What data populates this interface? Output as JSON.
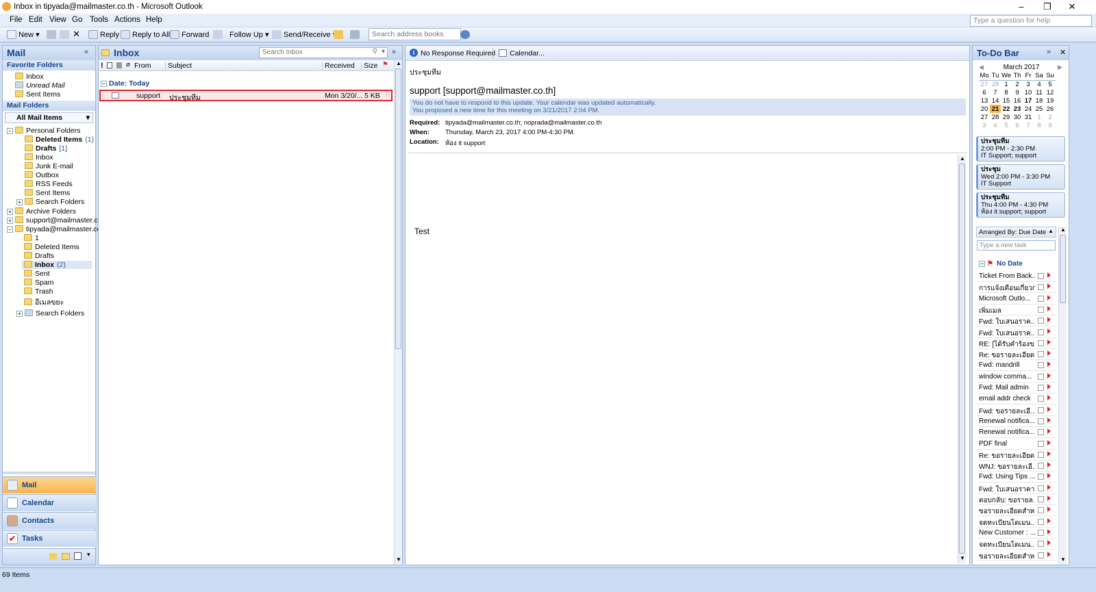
{
  "window": {
    "title": "Inbox in tipyada@mailmaster.co.th - Microsoft Outlook",
    "minimize": "–",
    "restore": "❐",
    "close": "✕"
  },
  "menu": {
    "file": "File",
    "edit": "Edit",
    "view": "View",
    "go": "Go",
    "tools": "Tools",
    "actions": "Actions",
    "help": "Help",
    "help_placeholder": "Type a question for help"
  },
  "toolbar": {
    "new": "New",
    "reply": "Reply",
    "reply_all": "Reply to All",
    "forward": "Forward",
    "follow_up": "Follow Up",
    "send_receive": "Send/Receive",
    "address_search_placeholder": "Search address books"
  },
  "nav": {
    "title": "Mail",
    "favorite_folders_label": "Favorite Folders",
    "favorites": [
      "Inbox",
      "Unread Mail",
      "Sent Items"
    ],
    "mail_folders_label": "Mail Folders",
    "all_mail_items": "All Mail Items",
    "personal_folders": "Personal Folders",
    "personal_children": [
      {
        "name": "Deleted Items",
        "count": "(1)"
      },
      {
        "name": "Drafts",
        "count": "[1]"
      },
      {
        "name": "Inbox",
        "count": ""
      },
      {
        "name": "Junk E-mail",
        "count": ""
      },
      {
        "name": "Outbox",
        "count": ""
      },
      {
        "name": "RSS Feeds",
        "count": ""
      },
      {
        "name": "Sent Items",
        "count": ""
      },
      {
        "name": "Search Folders",
        "count": ""
      }
    ],
    "archive_folders": "Archive Folders",
    "support_account": "support@mailmaster.co",
    "tipyada_account": "tipyada@mailmaster.co.",
    "tipyada_children": [
      {
        "name": "1",
        "count": ""
      },
      {
        "name": "Deleted Items",
        "count": ""
      },
      {
        "name": "Drafts",
        "count": ""
      },
      {
        "name": "Inbox",
        "count": "(2)"
      },
      {
        "name": "Sent",
        "count": ""
      },
      {
        "name": "Spam",
        "count": ""
      },
      {
        "name": "Trash",
        "count": ""
      },
      {
        "name": "อีเมลขยะ",
        "count": ""
      }
    ],
    "search_folders": "Search Folders",
    "buttons": [
      "Mail",
      "Calendar",
      "Contacts",
      "Tasks"
    ]
  },
  "inbox": {
    "title": "Inbox",
    "search_placeholder": "Search Inbox",
    "columns": {
      "from": "From",
      "subject": "Subject",
      "received": "Received",
      "size": "Size"
    },
    "group_label": "Date: Today",
    "messages": [
      {
        "from": "support",
        "subject": "ประชุมทีม",
        "received": "Mon 3/20/...",
        "size": "5 KB"
      }
    ]
  },
  "reading": {
    "no_response": "No Response Required",
    "calendar": "Calendar...",
    "subject": "ประชุมทีม",
    "sender": "support [support@mailmaster.co.th]",
    "info_line1": "You do not have to respond to this update. Your calendar was updated automatically.",
    "info_line2": "You proposed a new time for this meeting on 3/21/2017 2:04 PM.",
    "required_label": "Required:",
    "required_value": "tipyada@mailmaster.co.th; noprada@mailmaster.co.th",
    "when_label": "When:",
    "when_value": "Thursday, March 23, 2017 4:00 PM-4:30 PM.",
    "location_label": "Location:",
    "location_value": "ห้อง it support",
    "body": "Test"
  },
  "todo": {
    "title": "To-Do Bar",
    "month": "March 2017",
    "weekdays": [
      "Mo",
      "Tu",
      "We",
      "Th",
      "Fr",
      "Sa",
      "Su"
    ],
    "weeks": [
      [
        "27",
        "28",
        "1",
        "2",
        "3",
        "4",
        "5"
      ],
      [
        "6",
        "7",
        "8",
        "9",
        "10",
        "11",
        "12"
      ],
      [
        "13",
        "14",
        "15",
        "16",
        "17",
        "18",
        "19"
      ],
      [
        "20",
        "21",
        "22",
        "23",
        "24",
        "25",
        "26"
      ],
      [
        "27",
        "28",
        "29",
        "30",
        "31",
        "1",
        "2"
      ],
      [
        "3",
        "4",
        "5",
        "6",
        "7",
        "8",
        "9"
      ]
    ],
    "appointments": [
      {
        "title": "ประชุมทีม",
        "time": "2:00 PM - 2:30 PM",
        "where": "IT Support; support"
      },
      {
        "title": "ประชุม",
        "time": "Wed 2:00 PM - 3:30 PM",
        "where": "IT Support"
      },
      {
        "title": "ประชุมทีม",
        "time": "Thu 4:00 PM - 4:30 PM",
        "where": "ห้อง it support; support"
      }
    ],
    "arranged_by": "Arranged By: Due Date",
    "new_task_placeholder": "Type a new task",
    "no_date": "No Date",
    "tasks": [
      "Ticket From Back...",
      "การแจ้งเตือนเกี่ยวก...",
      "Microsoft Outlo...",
      "เพิ่มเมล",
      "Fwd: ใบเสนอราค...",
      "Fwd: ใบเสนอราค...",
      "RE: [ได้รับคำร้องข...",
      "Re: ขอรายละเอียด...",
      "Fwd: mandrill",
      "window comma...",
      "Fwd: Mail admin",
      "email addr check",
      "Fwd: ขอรายละเอี...",
      "Renewal notifica...",
      "Renewal notifica...",
      "PDF final",
      "Re: ขอรายละเอียด...",
      "WNJ: ขอรายละเอี...",
      "Fwd: Using Tips ...",
      "Fwd: ใบเสนอราคา",
      "ตอบกลับ: ขอรายล...",
      "ขอรายละเอียดสำห...",
      "จดทะเบียนโดเมน...",
      "New Customer : ...",
      "จดทะเบียนโดเมน...",
      "ขอรายละเอียดสำห..."
    ]
  },
  "status": {
    "items": "69 Items"
  },
  "colors": {
    "accent": "#15428b",
    "selected_border": "#e0252f",
    "nav_active": "#f9b64c"
  }
}
